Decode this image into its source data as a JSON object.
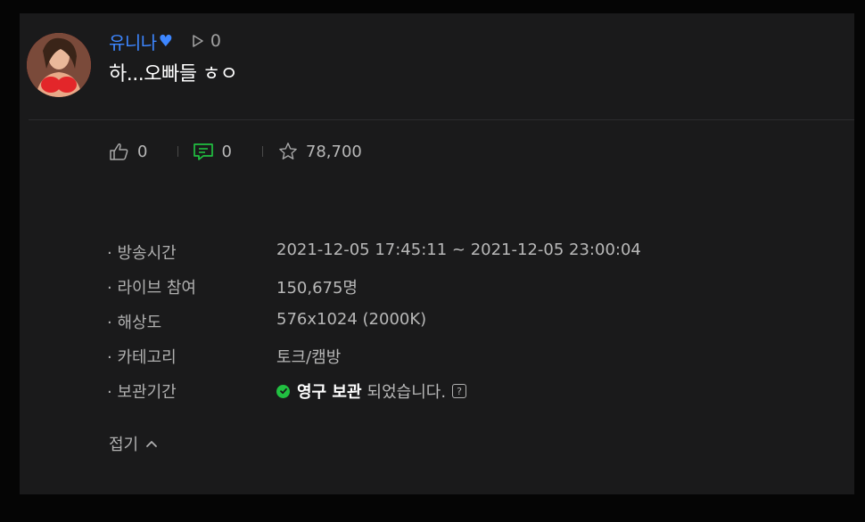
{
  "post": {
    "author": "유니나",
    "author_heart": "♥",
    "play_count": "0",
    "title": "하...오빠들 ㅎㅇ"
  },
  "stats": {
    "likes": "0",
    "comments": "0",
    "favorites": "78,700"
  },
  "details": {
    "broadcast_label": "· 방송시간",
    "broadcast_value": "2021-12-05 17:45:11 ~ 2021-12-05 23:00:04",
    "viewers_label": "· 라이브 참여",
    "viewers_value": "150,675명",
    "resolution_label": "· 해상도",
    "resolution_value": "576x1024 (2000K)",
    "category_label": "· 카테고리",
    "category_value": "토크/캠방",
    "storage_label": "· 보관기간",
    "storage_strong": "영구 보관",
    "storage_rest": "되었습니다.",
    "help_glyph": "?"
  },
  "fold_label": "접기",
  "colors": {
    "accent": "#3d86ff",
    "comment_icon": "#21c041",
    "check": "#21c041",
    "panel_bg": "#1a1a1b"
  },
  "icons": {
    "play": "play-icon",
    "like": "thumbs-up-icon",
    "comment": "comment-icon",
    "favorite": "star-icon",
    "storage": "check-circle-icon",
    "help": "help-icon",
    "fold": "chevron-up-icon"
  }
}
